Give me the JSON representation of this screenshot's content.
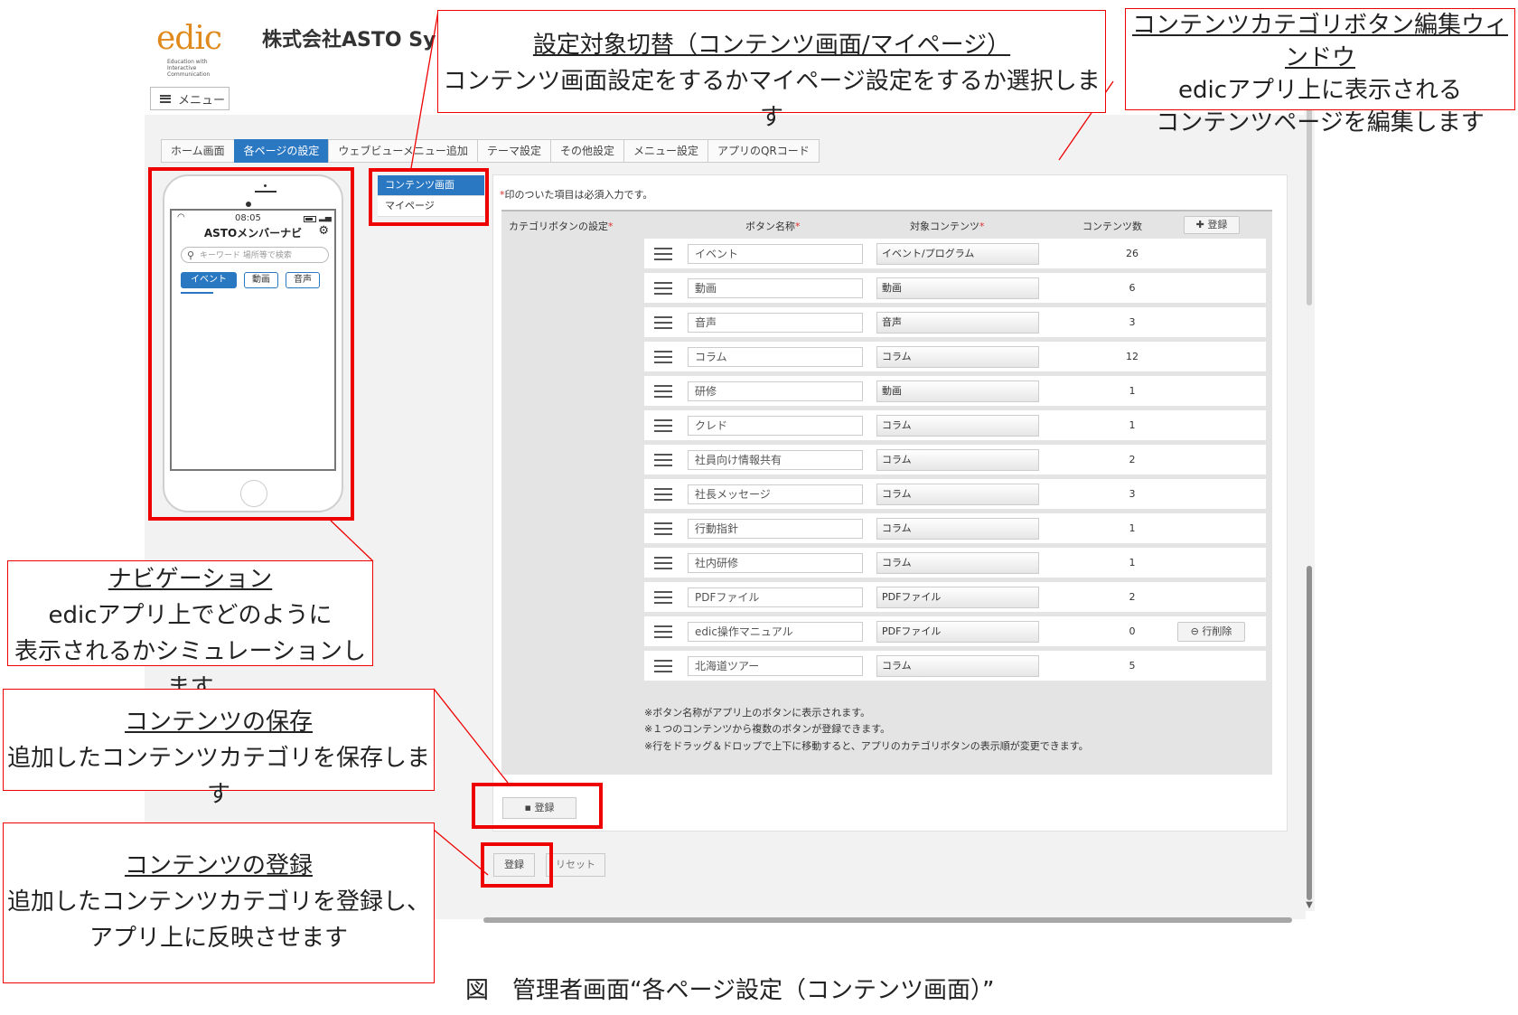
{
  "header": {
    "logo": "edic",
    "logo_sub_1": "Education with",
    "logo_sub_2": "Interactive",
    "logo_sub_3": "Communication",
    "company": "株式会社ASTO Sy",
    "menu_label": "メニュー"
  },
  "tabs": [
    "ホーム画面",
    "各ページの設定",
    "ウェブビューメニュー追加",
    "テーマ設定",
    "その他設定",
    "メニュー設定",
    "アプリのQRコード"
  ],
  "phone": {
    "time": "08:05",
    "app_title": "ASTOメンバーナビ",
    "search_placeholder": "キーワード 場所等で検索",
    "categories": [
      "イベント",
      "動画",
      "音声"
    ]
  },
  "subnav": [
    "コンテンツ画面",
    "マイページ"
  ],
  "panel": {
    "required_note": "印のついた項目は必須入力です。",
    "headers": {
      "category_settings": "カテゴリボタンの設定",
      "button_name": "ボタン名称",
      "target_content": "対象コンテンツ",
      "content_count": "コンテンツ数"
    },
    "add_label": "登録",
    "delete_label": "行削除",
    "rows": [
      {
        "name": "イベント",
        "target": "イベント/プログラム",
        "count": "26"
      },
      {
        "name": "動画",
        "target": "動画",
        "count": "6"
      },
      {
        "name": "音声",
        "target": "音声",
        "count": "3"
      },
      {
        "name": "コラム",
        "target": "コラム",
        "count": "12"
      },
      {
        "name": "研修",
        "target": "動画",
        "count": "1"
      },
      {
        "name": "クレド",
        "target": "コラム",
        "count": "1"
      },
      {
        "name": "社員向け情報共有",
        "target": "コラム",
        "count": "2"
      },
      {
        "name": "社長メッセージ",
        "target": "コラム",
        "count": "3"
      },
      {
        "name": "行動指針",
        "target": "コラム",
        "count": "1"
      },
      {
        "name": "社内研修",
        "target": "コラム",
        "count": "1"
      },
      {
        "name": "PDFファイル",
        "target": "PDFファイル",
        "count": "2"
      },
      {
        "name": "edic操作マニュアル",
        "target": "PDFファイル",
        "count": "0"
      },
      {
        "name": "北海道ツアー",
        "target": "コラム",
        "count": "5"
      }
    ],
    "notes": [
      "※ボタン名称がアプリ上のボタンに表示されます。",
      "※１つのコンテンツから複数のボタンが登録できます。",
      "※行をドラッグ＆ドロップで上下に移動すると、アプリのカテゴリボタンの表示順が変更できます。"
    ],
    "save_label": "登録"
  },
  "footer": {
    "register_label": "登録",
    "reset_label": "リセット"
  },
  "annotations": {
    "switch": {
      "title": "設定対象切替（コンテンツ画面/マイページ）",
      "body": "コンテンツ画面設定をするかマイページ設定をするか選択します"
    },
    "editor": {
      "title": "コンテンツカテゴリボタン編集ウィンドウ",
      "body1": "edicアプリ上に表示される",
      "body2": "コンテンツページを編集します"
    },
    "nav": {
      "title": "ナビゲーション",
      "body1": "edicアプリ上でどのように",
      "body2": "表示されるかシミュレーションします"
    },
    "save": {
      "title": "コンテンツの保存",
      "body": "追加したコンテンツカテゴリを保存します"
    },
    "register": {
      "title": "コンテンツの登録",
      "body1": "追加したコンテンツカテゴリを登録し、",
      "body2": "アプリ上に反映させます"
    }
  },
  "caption": "図　管理者画面“各ページ設定（コンテンツ画面）”",
  "colors": {
    "accent": "#2a78c2",
    "highlight": "#ee0000",
    "logo": "#e08a1e"
  }
}
